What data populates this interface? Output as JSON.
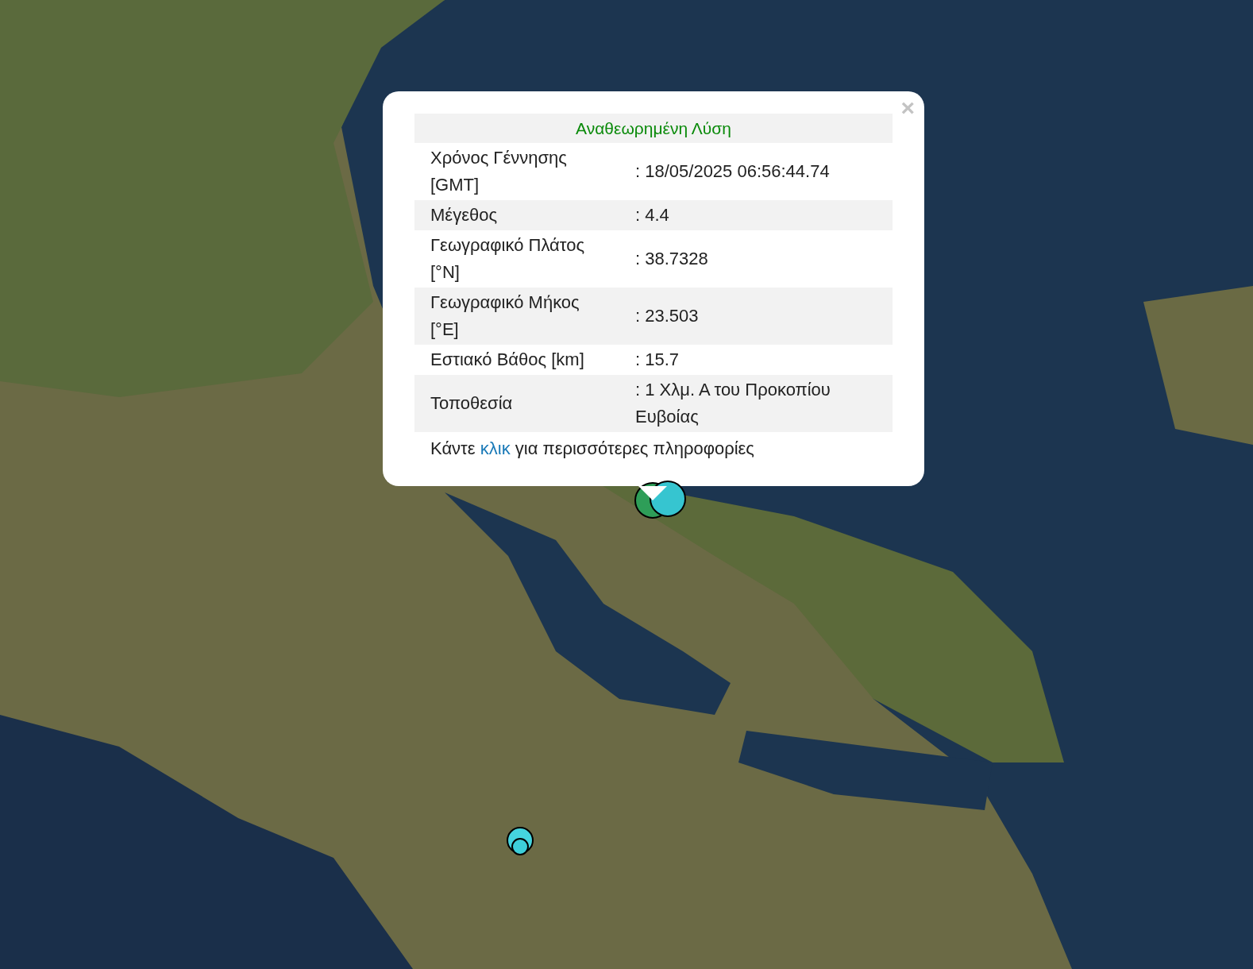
{
  "popup": {
    "close": "×",
    "title": "Αναθεωρημένη Λύση",
    "rows": [
      {
        "label": "Χρόνος Γέννησης [GMT]",
        "value": ": 18/05/2025 06:56:44.74"
      },
      {
        "label": "Μέγεθος",
        "value": ": 4.4"
      },
      {
        "label": "Γεωγραφικό Πλάτος [°N]",
        "value": ": 38.7328"
      },
      {
        "label": "Γεωγραφικό Μήκος [°E]",
        "value": ": 23.503"
      },
      {
        "label": "Εστιακό Βάθος [km]",
        "value": ": 15.7"
      },
      {
        "label": "Τοποθεσία",
        "value": ": 1 Χλμ. Α του Προκοπίου Ευβοίας"
      }
    ],
    "footer": {
      "before": "Κάντε",
      "link": "κλικ",
      "after": "για περισσότερες πληροφορίες"
    }
  },
  "markers": [
    {
      "color": "#2e9e58"
    },
    {
      "color": "#36c5d0"
    },
    {
      "color": "#3dcfda"
    },
    {
      "color": "#45d4de"
    }
  ]
}
